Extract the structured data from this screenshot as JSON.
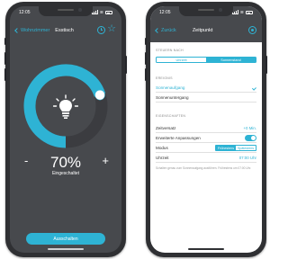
{
  "left": {
    "time": "12:05",
    "back_label": "Wohnzimmer",
    "title": "Esstisch",
    "brightness_value": "70%",
    "brightness_fraction": 0.7,
    "status": "Eingeschaltet",
    "minus": "-",
    "plus": "+",
    "off_button": "Ausschalten",
    "star_glyph": "☆"
  },
  "right": {
    "time": "12:05",
    "back_label": "Zurück",
    "title": "Zeitpunkt",
    "section_control": "STEUERN NACH",
    "control_options": [
      "Uhrzeit",
      "Sonnenstand"
    ],
    "control_selected": "Sonnenstand",
    "section_event": "EREIGNIS",
    "events": [
      "Sonnenaufgang",
      "Sonnenuntergang"
    ],
    "event_selected": "Sonnenaufgang",
    "section_props": "EIGENSCHAFTEN",
    "offset_label": "Zeitversatz",
    "offset_value": "+0 Min.",
    "advanced_label": "Erweiterte Anpassungen",
    "advanced_on": true,
    "mode_label": "Modus",
    "mode_options": [
      "Frühestens",
      "Spätestens"
    ],
    "mode_selected": "Frühestens",
    "time_label": "Uhrzeit",
    "time_value": "07:00 Uhr",
    "note": "Schalten genau zum Sonnenaufgang ausführen. Frühestens um 07:00 Uhr."
  },
  "colors": {
    "accent": "#2eb3d4",
    "dark_bg": "#47494d",
    "frame": "#2f3033"
  }
}
